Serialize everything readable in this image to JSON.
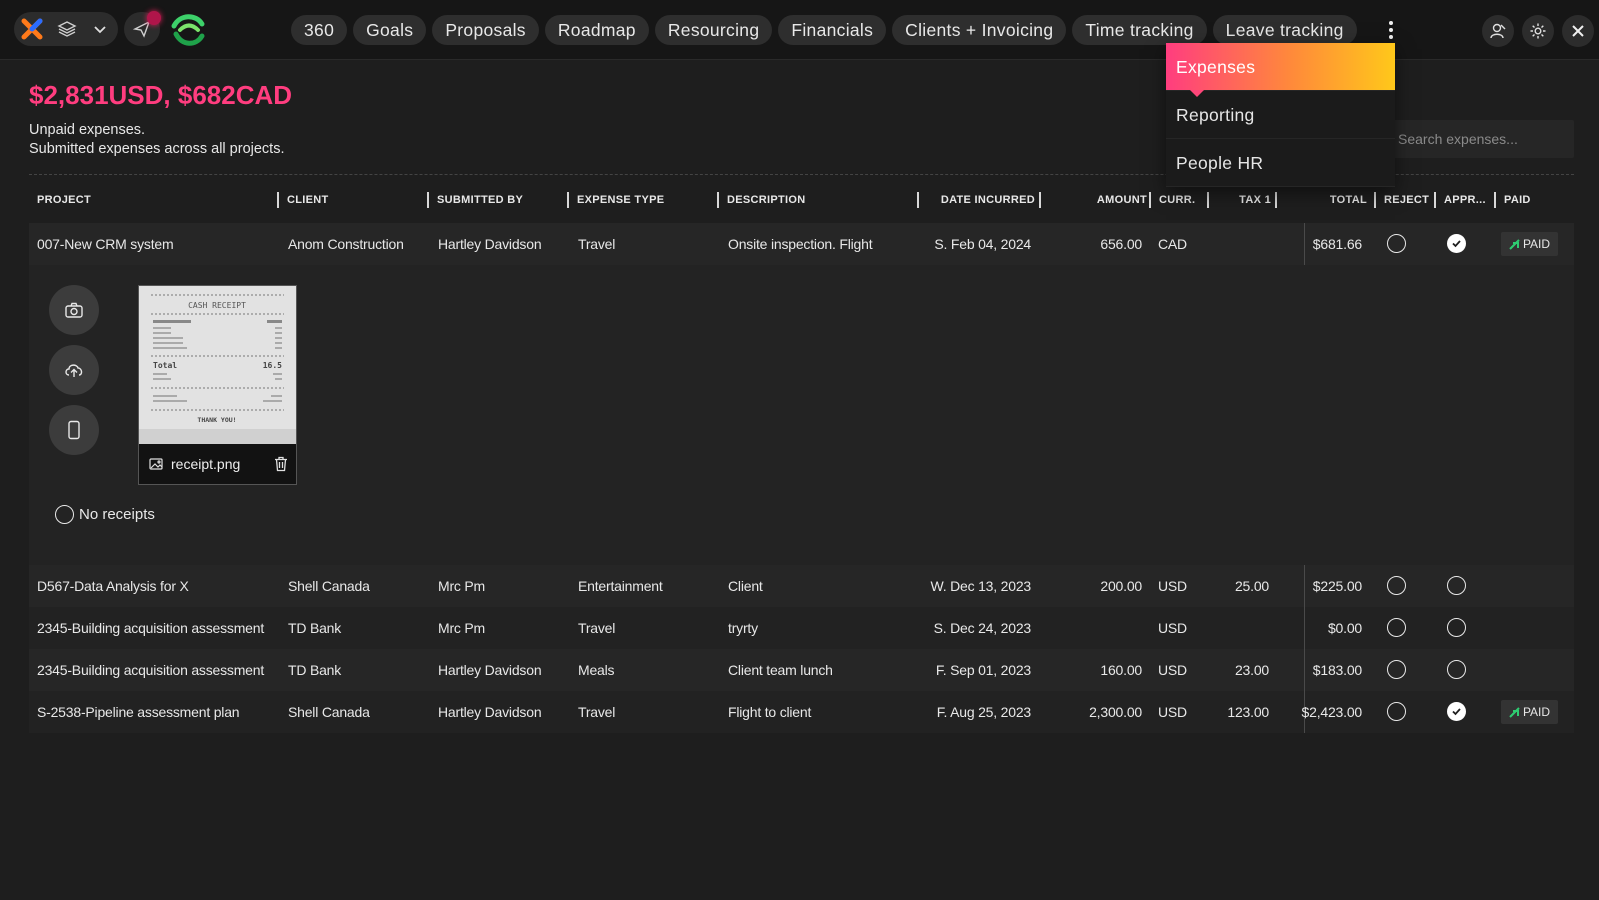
{
  "nav": {
    "tabs": [
      "360",
      "Goals",
      "Proposals",
      "Roadmap",
      "Resourcing",
      "Financials",
      "Clients + Invoicing",
      "Time tracking",
      "Leave tracking"
    ],
    "more_menu": [
      "Expenses",
      "Reporting",
      "People HR"
    ],
    "active_menu_item": "Expenses"
  },
  "header": {
    "total": "$2,831USD, $682CAD",
    "subtitle_1": "Unpaid expenses.",
    "subtitle_2": "Submitted expenses across all projects.",
    "search_placeholder": "Search expenses..."
  },
  "table": {
    "columns": [
      "PROJECT",
      "CLIENT",
      "SUBMITTED BY",
      "EXPENSE TYPE",
      "DESCRIPTION",
      "DATE INCURRED",
      "AMOUNT",
      "CURR.",
      "TAX 1",
      "TOTAL",
      "REJECT",
      "APPR...",
      "PAID"
    ],
    "rows": [
      {
        "project": "007-New CRM system",
        "client": "Anom Construction",
        "submitted_by": "Hartley Davidson",
        "type": "Travel",
        "description": "Onsite inspection. Flight",
        "date": "S. Feb 04, 2024",
        "amount": "656.00",
        "currency": "CAD",
        "tax": "",
        "total": "$681.66",
        "approved": true,
        "paid": "PAID"
      },
      {
        "project": "D567-Data Analysis for X",
        "client": "Shell Canada",
        "submitted_by": "Mrc Pm",
        "type": "Entertainment",
        "description": "Client",
        "date": "W. Dec 13, 2023",
        "amount": "200.00",
        "currency": "USD",
        "tax": "25.00",
        "total": "$225.00",
        "approved": false,
        "paid": ""
      },
      {
        "project": "2345-Building acquisition assessment",
        "client": "TD Bank",
        "submitted_by": "Mrc Pm",
        "type": "Travel",
        "description": "tryrty",
        "date": "S. Dec 24, 2023",
        "amount": "",
        "currency": "USD",
        "tax": "",
        "total": "$0.00",
        "approved": false,
        "paid": ""
      },
      {
        "project": "2345-Building acquisition assessment",
        "client": "TD Bank",
        "submitted_by": "Hartley Davidson",
        "type": "Meals",
        "description": "Client team lunch",
        "date": "F. Sep 01, 2023",
        "amount": "160.00",
        "currency": "USD",
        "tax": "23.00",
        "total": "$183.00",
        "approved": false,
        "paid": ""
      },
      {
        "project": "S-2538-Pipeline assessment plan",
        "client": "Shell Canada",
        "submitted_by": "Hartley Davidson",
        "type": "Travel",
        "description": "Flight to client",
        "date": "F. Aug 25, 2023",
        "amount": "2,300.00",
        "currency": "USD",
        "tax": "123.00",
        "total": "$2,423.00",
        "approved": true,
        "paid": "PAID"
      }
    ]
  },
  "receipt": {
    "file_name": "receipt.png",
    "no_receipts_label": "No receipts",
    "image_title": "CASH RECEIPT",
    "image_total_label": "Total",
    "image_total_value": "16.5",
    "image_footer": "THANK YOU!"
  },
  "colors": {
    "accent_pink": "#ff3d7f",
    "accent_orange": "#ff8a3a",
    "accent_yellow": "#ffc81a",
    "paid_green": "#2ecc71"
  }
}
